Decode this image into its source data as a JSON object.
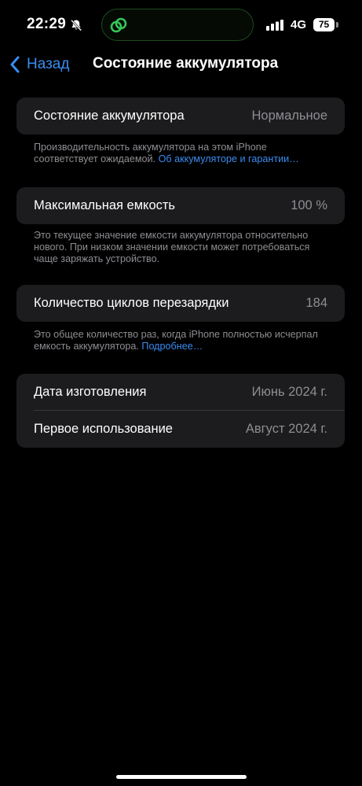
{
  "status_bar": {
    "time": "22:29",
    "network": "4G",
    "battery_level": "75",
    "icons": [
      "bell-slash-icon",
      "shareplay-icon",
      "cellular-signal-icon"
    ],
    "island_color": "#34c759"
  },
  "nav": {
    "back_label": "Назад",
    "title": "Состояние аккумулятора"
  },
  "sections": {
    "health": {
      "label": "Состояние аккумулятора",
      "value": "Нормальное",
      "footnote_text": "Производительность аккумулятора на этом iPhone соответствует ожидаемой. ",
      "footnote_link": "Об аккумуляторе и гарантии…"
    },
    "capacity": {
      "label": "Максимальная емкость",
      "value": "100 %",
      "footnote_text": "Это текущее значение емкости аккумулятора относительно нового. При низком значении емкости может потребоваться чаще заряжать устройство."
    },
    "cycles": {
      "label": "Количество циклов перезарядки",
      "value": "184",
      "footnote_text": "Это общее количество раз, когда iPhone полностью исчерпал емкость аккумулятора. ",
      "footnote_link": "Подробнее…"
    },
    "dates": {
      "manufacture_label": "Дата изготовления",
      "manufacture_value": "Июнь 2024 г.",
      "first_use_label": "Первое использование",
      "first_use_value": "Август 2024 г."
    }
  },
  "colors": {
    "accent": "#3a8cf0",
    "background": "#000000",
    "card": "#1c1c1e",
    "secondary_text": "#8e8e93"
  }
}
